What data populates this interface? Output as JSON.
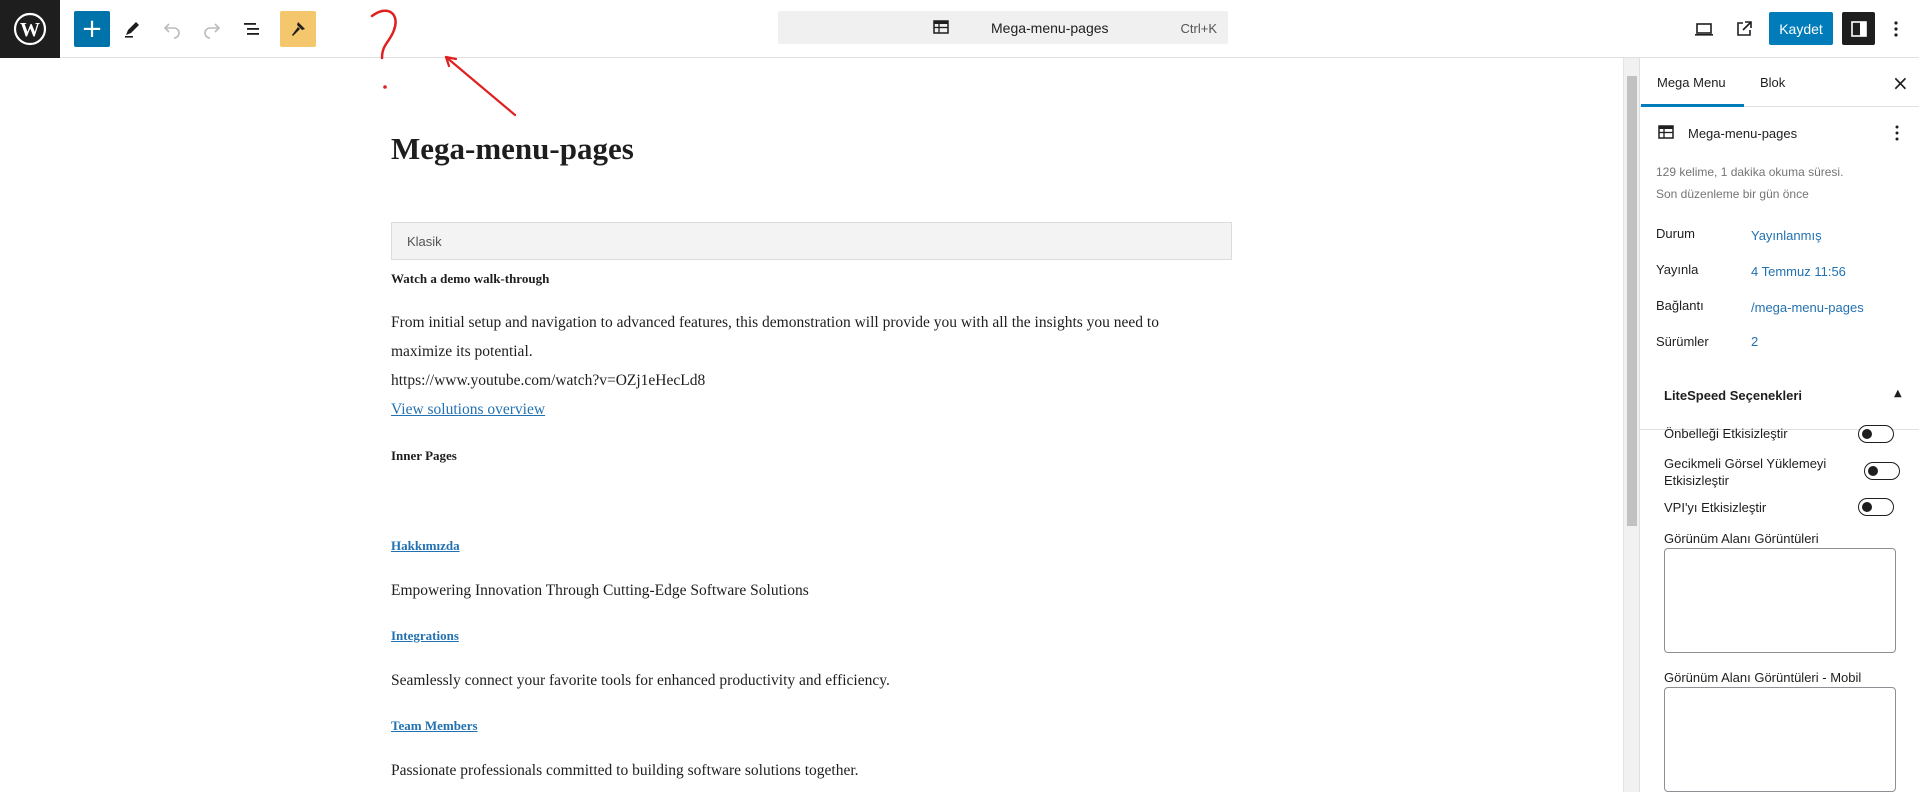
{
  "toolbar": {
    "document_title": "Mega-menu-pages",
    "shortcut": "Ctrl+K",
    "save_label": "Kaydet"
  },
  "post": {
    "title": "Mega-menu-pages",
    "classic_block_label": "Klasik",
    "heading_demo": "Watch a demo walk-through",
    "demo_text_line1": "From initial setup and navigation to advanced features, this demonstration will provide you with all the insights you need to",
    "demo_text_line2": "maximize its potential.",
    "video_url": "https://www.youtube.com/watch?v=OZj1eHecLd8",
    "view_solutions": "View solutions overview",
    "heading_inner": "Inner Pages",
    "link_about": "Hakkımızda",
    "text_about": "Empowering Innovation Through Cutting-Edge Software Solutions",
    "link_integrations": "Integrations",
    "text_integrations": "Seamlessly connect your favorite tools for enhanced productivity and efficiency.",
    "link_team": "Team Members",
    "text_team": "Passionate professionals committed to building software solutions together."
  },
  "sidebar": {
    "tabs": [
      "Mega Menu",
      "Blok"
    ],
    "post_name": "Mega-menu-pages",
    "meta_line1": "129 kelime, 1 dakika okuma süresi.",
    "meta_line2": "Son düzenleme bir gün önce",
    "rows": [
      {
        "label": "Durum",
        "value": "Yayınlanmış"
      },
      {
        "label": "Yayınla",
        "value": "4 Temmuz 11:56"
      },
      {
        "label": "Bağlantı",
        "value": "/mega-menu-pages"
      },
      {
        "label": "Sürümler",
        "value": "2"
      }
    ],
    "litespeed": {
      "title": "LiteSpeed Seçenekleri",
      "toggle1": "Önbelleği Etkisizleştir",
      "toggle2_line1": "Gecikmeli Görsel Yüklemeyi",
      "toggle2_line2": "Etkisizleştir",
      "toggle3": "VPI'yı Etkisizleştir",
      "field1": "Görünüm Alanı Görüntüleri",
      "field2": "Görünüm Alanı Görüntüleri - Mobil"
    }
  },
  "colors": {
    "accent": "#007cba",
    "link": "#2271b1",
    "tool_highlight": "#f5c76c",
    "annotation": "#e02020"
  }
}
